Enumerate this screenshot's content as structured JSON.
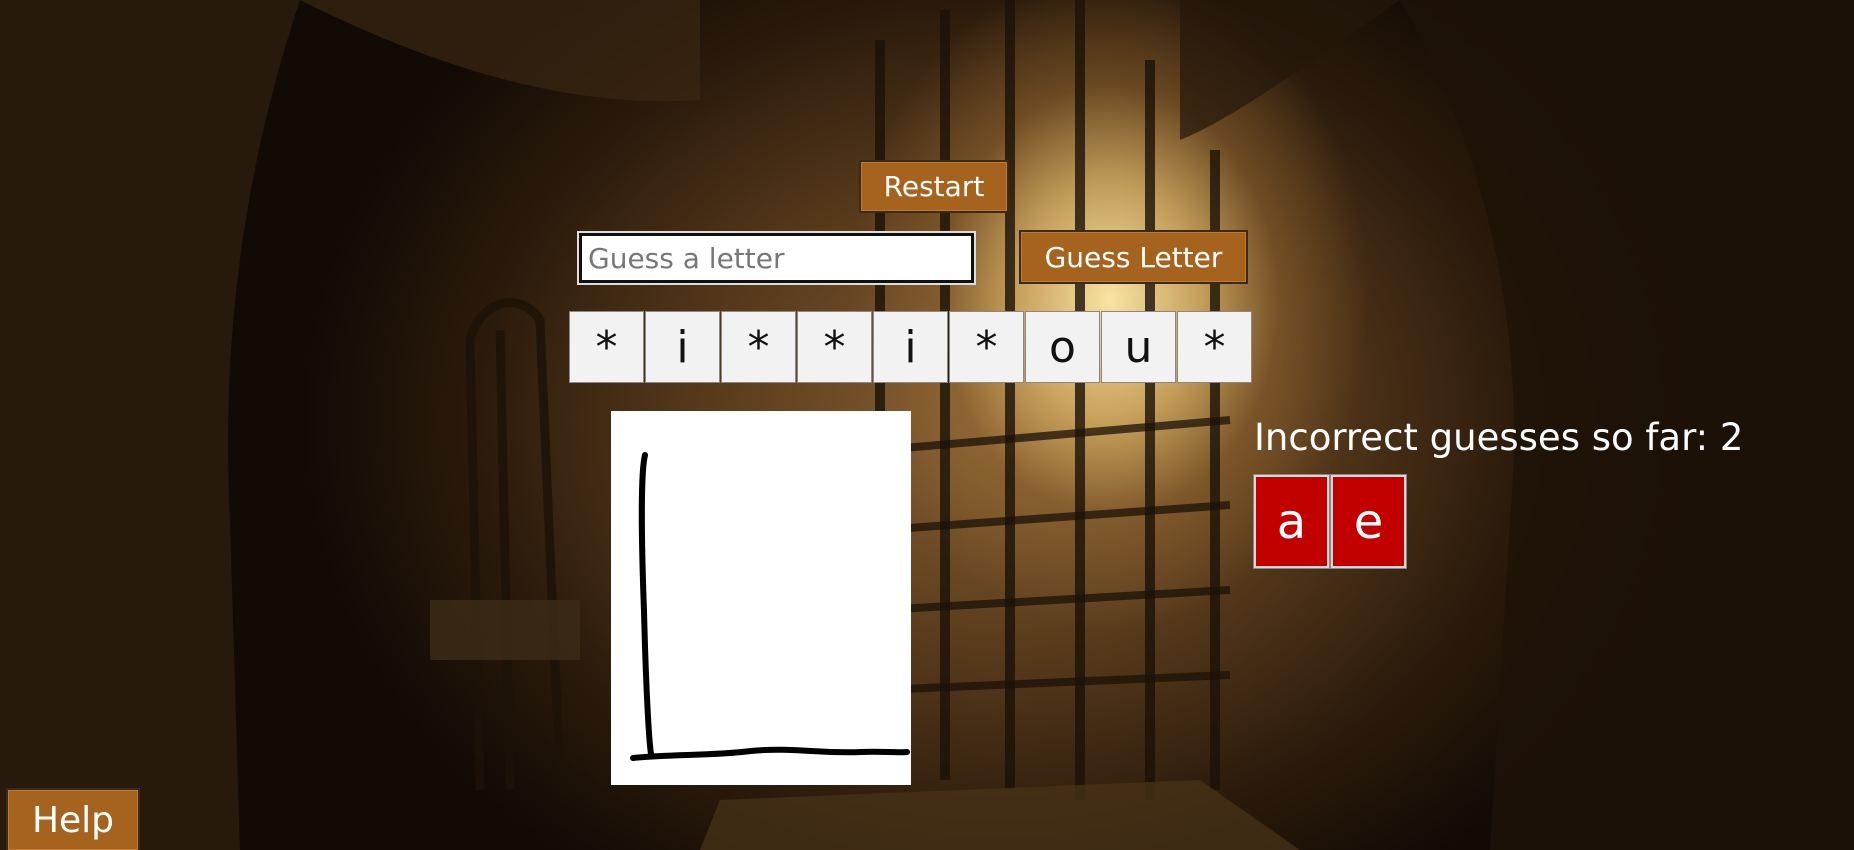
{
  "controls": {
    "restart_label": "Restart",
    "guess_placeholder": "Guess a letter",
    "guess_value": "",
    "guess_button_label": "Guess Letter",
    "help_label": "Help"
  },
  "word": {
    "letters": [
      "*",
      "i",
      "*",
      "*",
      "i",
      "*",
      "o",
      "u",
      "*"
    ]
  },
  "incorrect": {
    "label": "Incorrect guesses so far: 2",
    "letters": [
      "a",
      "e"
    ]
  },
  "hangman": {
    "stage_drawn": [
      "base",
      "pole"
    ]
  },
  "colors": {
    "button": "#a5631e",
    "wrong_tile": "#c20000",
    "slot_tile": "#f2f2f2"
  }
}
